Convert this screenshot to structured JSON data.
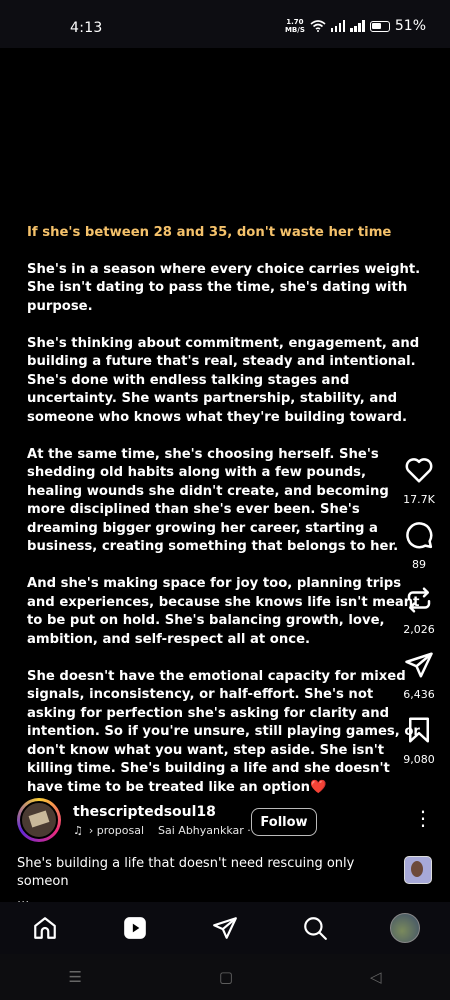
{
  "status_bar": {
    "time": "4:13",
    "speed_value": "1.70",
    "speed_unit": "MB/S",
    "battery": "51%"
  },
  "reel": {
    "heading": "If she's between 28 and 35, don't waste her time",
    "paragraphs": [
      "She's in a season where every choice carries weight. She isn't dating to pass the time, she's dating with purpose.",
      "She's thinking about commitment, engagement, and building a future that's real, steady and intentional. She's done with endless talking stages and uncertainty. She wants partnership, stability, and someone who knows what they're building toward.",
      "At the same time, she's choosing herself. She's shedding old habits along with a few pounds, healing wounds she didn't create, and becoming more disciplined than she's ever been. She's dreaming bigger growing her career, starting a business, creating something that belongs to her.",
      "And she's making space for joy too, planning trips and experiences, because she knows life isn't meant to be put on hold. She's balancing growth, love, ambition, and self-respect all at once.",
      "She doesn't have the emotional capacity for mixed signals, inconsistency, or half-effort. She's not asking for perfection she's asking for clarity and intention. So if you're unsure, still playing games, or don't know what you want, step aside. She isn't killing time. She's building a life and she doesn't have time to be treated like an option"
    ],
    "heart_emoji": "❤️",
    "accent_color": "#f5c26b"
  },
  "actions": {
    "likes": "17.7K",
    "comments": "89",
    "reposts": "2,026",
    "shares": "6,436",
    "saves": "9,080"
  },
  "profile": {
    "username": "thescriptedsoul18",
    "audio_left": "› proposal",
    "audio_right": "Sai Abhyankkar ·",
    "follow_label": "Follow",
    "more_label": "⋮"
  },
  "caption": {
    "text": "She's building a life that doesn't need rescuing only someon",
    "ellipsis": "..."
  },
  "nav": {
    "items": [
      "home-icon",
      "reels-icon",
      "send-icon",
      "search-icon",
      "profile-avatar"
    ]
  },
  "system_nav": {
    "recents": "☰",
    "home": "▢",
    "back": "◁"
  }
}
